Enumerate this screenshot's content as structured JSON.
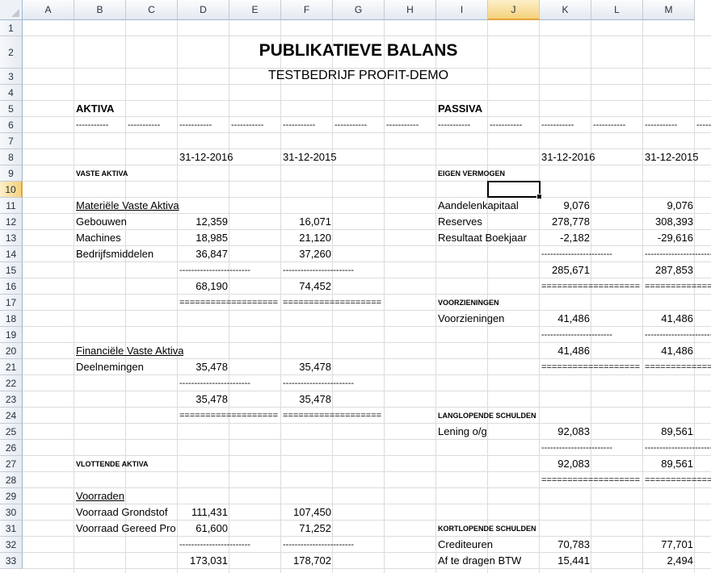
{
  "columns": [
    "A",
    "B",
    "C",
    "D",
    "E",
    "F",
    "G",
    "H",
    "I",
    "J",
    "K",
    "L",
    "M"
  ],
  "rows": [
    "1",
    "2",
    "3",
    "4",
    "5",
    "6",
    "7",
    "8",
    "9",
    "10",
    "11",
    "12",
    "13",
    "14",
    "15",
    "16",
    "17",
    "18",
    "19",
    "20",
    "21",
    "22",
    "23",
    "24",
    "25",
    "26",
    "27",
    "28",
    "29",
    "30",
    "31",
    "32",
    "33"
  ],
  "selected_cell": {
    "column": "J",
    "row": "10"
  },
  "header": {
    "title": "PUBLIKATIEVE BALANS",
    "subtitle": "TESTBEDRIJF PROFIT-DEMO"
  },
  "aktiva": {
    "heading": "AKTIVA",
    "date_current": "31-12-2016",
    "date_previous": "31-12-2015",
    "vaste_aktiva": "VASTE AKTIVA",
    "materiele_title": "Materiële Vaste Aktiva",
    "gebouwen": {
      "label": "Gebouwen",
      "cur": "12,359",
      "prev": "16,071"
    },
    "machines": {
      "label": "Machines",
      "cur": "18,985",
      "prev": "21,120"
    },
    "bedrijfsmiddelen": {
      "label": "Bedrijfsmiddelen",
      "cur": "36,847",
      "prev": "37,260"
    },
    "materiele_total": {
      "cur": "68,190",
      "prev": "74,452"
    },
    "financiele_title": "Financiële Vaste Aktiva",
    "deelnemingen": {
      "label": "Deelnemingen",
      "cur": "35,478",
      "prev": "35,478"
    },
    "financiele_total": {
      "cur": "35,478",
      "prev": "35,478"
    },
    "vlottende_aktiva": "VLOTTENDE AKTIVA",
    "voorraden_title": "Voorraden",
    "voorraad_grondstof": {
      "label": "Voorraad Grondstof",
      "cur": "111,431",
      "prev": "107,450"
    },
    "voorraad_gereed": {
      "label": "Voorraad Gereed Pro",
      "cur": "61,600",
      "prev": "71,252"
    },
    "voorraden_total": {
      "cur": "173,031",
      "prev": "178,702"
    }
  },
  "passiva": {
    "heading": "PASSIVA",
    "date_current": "31-12-2016",
    "date_previous": "31-12-2015",
    "eigen_vermogen": "EIGEN VERMOGEN",
    "aandelenkapitaal": {
      "label": "Aandelenkapitaal",
      "cur": "9,076",
      "prev": "9,076"
    },
    "reserves": {
      "label": "Reserves",
      "cur": "278,778",
      "prev": "308,393"
    },
    "resultaat": {
      "label": "Resultaat Boekjaar",
      "cur": "-2,182",
      "prev": "-29,616"
    },
    "eigen_total": {
      "cur": "285,671",
      "prev": "287,853"
    },
    "voorzieningen_heading": "VOORZIENINGEN",
    "voorzieningen": {
      "label": "Voorzieningen",
      "cur": "41,486",
      "prev": "41,486"
    },
    "voorzieningen_total": {
      "cur": "41,486",
      "prev": "41,486"
    },
    "langlopende_heading": "LANGLOPENDE SCHULDEN",
    "lening": {
      "label": "Lening o/g",
      "cur": "92,083",
      "prev": "89,561"
    },
    "langlopende_total": {
      "cur": "92,083",
      "prev": "89,561"
    },
    "kortlopende_heading": "KORTLOPENDE SCHULDEN",
    "crediteuren": {
      "label": "Crediteuren",
      "cur": "70,783",
      "prev": "77,701"
    },
    "btw": {
      "label": "Af te dragen BTW",
      "cur": "15,441",
      "prev": "2,494"
    }
  },
  "separators": {
    "dash_short": "-----------",
    "dash_long": "------------------------",
    "equals_long": "==================="
  }
}
